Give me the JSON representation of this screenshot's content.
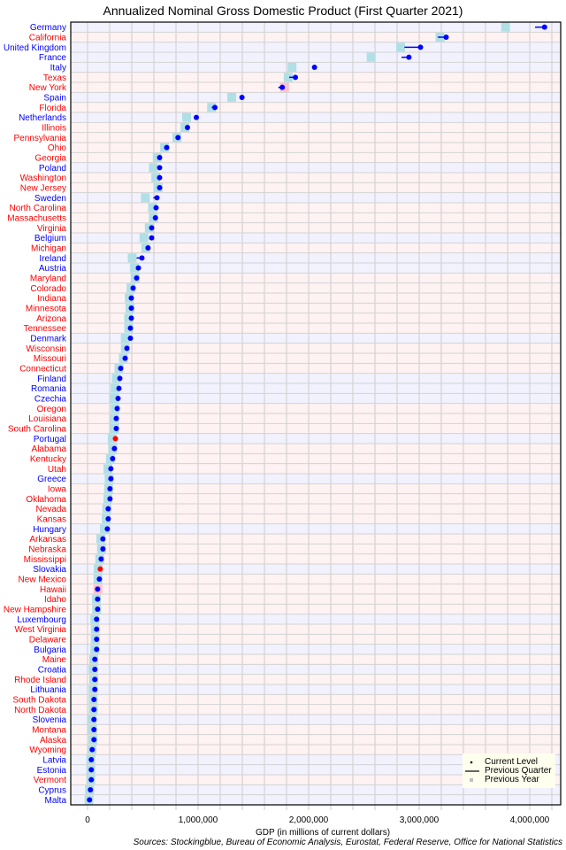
{
  "chart_data": {
    "type": "dot",
    "title": "Annualized Nominal Gross Domestic Product (First Quarter 2021)",
    "xlabel": "GDP (in millions of current dollars)",
    "ylabel": "",
    "source": "Sources: Stockingblue, Bureau of Economic Analysis, Eurostat, Federal Reserve, Office for National Statistics",
    "xlim": [
      -152000,
      4280000
    ],
    "xticks": [
      0,
      1000000,
      2000000,
      3000000,
      4000000
    ],
    "xtick_labels": [
      "0",
      "1,000,000",
      "2,000,000",
      "3,000,000",
      "4,000,000"
    ],
    "minor_tick_step": 200000,
    "grid": true,
    "legend_position": "bottom-right",
    "legend": [
      {
        "symbol": "dot",
        "label": "Current Level"
      },
      {
        "symbol": "line",
        "label": "Previous Quarter"
      },
      {
        "symbol": "square",
        "label": "Previous Year"
      }
    ],
    "colors": {
      "state_label": "#ff0000",
      "country_label": "#0000ff",
      "state_row": "#fff2f2",
      "country_row": "#f2f2ff",
      "dot": "#0000ff",
      "dot_highlight": "#ff0000",
      "prev_year_up": "#b0e0e6",
      "prev_year_down": "#ffc0cb",
      "grid": "#d3d3d3"
    },
    "series": [
      {
        "name": "Germany",
        "type": "country",
        "current": 4134000,
        "prev_quarter": 4048000,
        "prev_year": 3781000
      },
      {
        "name": "California",
        "type": "state",
        "current": 3244000,
        "prev_quarter": 3169000,
        "prev_year": 3188000
      },
      {
        "name": "United Kingdom",
        "type": "country",
        "current": 3012000,
        "prev_quarter": 2867000,
        "prev_year": 2832000
      },
      {
        "name": "France",
        "type": "country",
        "current": 2907000,
        "prev_quarter": 2840000,
        "prev_year": 2565000
      },
      {
        "name": "Italy",
        "type": "country",
        "current": 2053000,
        "prev_quarter": 2045000,
        "prev_year": 1850000
      },
      {
        "name": "Texas",
        "type": "state",
        "current": 1880000,
        "prev_quarter": 1824000,
        "prev_year": 1815000
      },
      {
        "name": "New York",
        "type": "state",
        "current": 1761000,
        "prev_quarter": 1726000,
        "prev_year": 1782000
      },
      {
        "name": "Spain",
        "type": "country",
        "current": 1397000,
        "prev_quarter": 1395000,
        "prev_year": 1304000
      },
      {
        "name": "Florida",
        "type": "state",
        "current": 1152000,
        "prev_quarter": 1124000,
        "prev_year": 1122000
      },
      {
        "name": "Netherlands",
        "type": "country",
        "current": 984000,
        "prev_quarter": 980000,
        "prev_year": 896000
      },
      {
        "name": "Illinois",
        "type": "state",
        "current": 904000,
        "prev_quarter": 885000,
        "prev_year": 880000
      },
      {
        "name": "Pennsylvania",
        "type": "state",
        "current": 818000,
        "prev_quarter": 800000,
        "prev_year": 808000
      },
      {
        "name": "Ohio",
        "type": "state",
        "current": 716000,
        "prev_quarter": 700000,
        "prev_year": 697000
      },
      {
        "name": "Georgia",
        "type": "state",
        "current": 652000,
        "prev_quarter": 640000,
        "prev_year": 630000
      },
      {
        "name": "Poland",
        "type": "country",
        "current": 652000,
        "prev_quarter": 648000,
        "prev_year": 595000
      },
      {
        "name": "Washington",
        "type": "state",
        "current": 652000,
        "prev_quarter": 640000,
        "prev_year": 617000
      },
      {
        "name": "New Jersey",
        "type": "state",
        "current": 652000,
        "prev_quarter": 640000,
        "prev_year": 638000
      },
      {
        "name": "Sweden",
        "type": "country",
        "current": 628000,
        "prev_quarter": 595000,
        "prev_year": 523000
      },
      {
        "name": "North Carolina",
        "type": "state",
        "current": 620000,
        "prev_quarter": 608000,
        "prev_year": 588000
      },
      {
        "name": "Massachusetts",
        "type": "state",
        "current": 614000,
        "prev_quarter": 604000,
        "prev_year": 595000
      },
      {
        "name": "Virginia",
        "type": "state",
        "current": 580000,
        "prev_quarter": 568000,
        "prev_year": 558000
      },
      {
        "name": "Belgium",
        "type": "country",
        "current": 580000,
        "prev_quarter": 562000,
        "prev_year": 510000
      },
      {
        "name": "Michigan",
        "type": "state",
        "current": 547000,
        "prev_quarter": 540000,
        "prev_year": 526000
      },
      {
        "name": "Ireland",
        "type": "country",
        "current": 492000,
        "prev_quarter": 444000,
        "prev_year": 404000
      },
      {
        "name": "Austria",
        "type": "country",
        "current": 460000,
        "prev_quarter": 452000,
        "prev_year": 425000
      },
      {
        "name": "Maryland",
        "type": "state",
        "current": 444000,
        "prev_quarter": 436000,
        "prev_year": 430000
      },
      {
        "name": "Colorado",
        "type": "state",
        "current": 412000,
        "prev_quarter": 404000,
        "prev_year": 393000
      },
      {
        "name": "Indiana",
        "type": "state",
        "current": 396000,
        "prev_quarter": 388000,
        "prev_year": 377000
      },
      {
        "name": "Minnesota",
        "type": "state",
        "current": 396000,
        "prev_quarter": 388000,
        "prev_year": 383000
      },
      {
        "name": "Arizona",
        "type": "state",
        "current": 396000,
        "prev_quarter": 388000,
        "prev_year": 372000
      },
      {
        "name": "Tennessee",
        "type": "state",
        "current": 388000,
        "prev_quarter": 380000,
        "prev_year": 372000
      },
      {
        "name": "Denmark",
        "type": "country",
        "current": 388000,
        "prev_quarter": 384000,
        "prev_year": 341000
      },
      {
        "name": "Wisconsin",
        "type": "state",
        "current": 356000,
        "prev_quarter": 350000,
        "prev_year": 341000
      },
      {
        "name": "Missouri",
        "type": "state",
        "current": 340000,
        "prev_quarter": 334000,
        "prev_year": 324000
      },
      {
        "name": "Connecticut",
        "type": "state",
        "current": 300000,
        "prev_quarter": 294000,
        "prev_year": 284000
      },
      {
        "name": "Finland",
        "type": "country",
        "current": 292000,
        "prev_quarter": 288000,
        "prev_year": 260000
      },
      {
        "name": "Romania",
        "type": "country",
        "current": 284000,
        "prev_quarter": 280000,
        "prev_year": 249000
      },
      {
        "name": "Czechia",
        "type": "country",
        "current": 276000,
        "prev_quarter": 272000,
        "prev_year": 244000
      },
      {
        "name": "Oregon",
        "type": "state",
        "current": 268000,
        "prev_quarter": 264000,
        "prev_year": 249000
      },
      {
        "name": "Louisiana",
        "type": "state",
        "current": 260000,
        "prev_quarter": 256000,
        "prev_year": 244000
      },
      {
        "name": "South Carolina",
        "type": "state",
        "current": 260000,
        "prev_quarter": 256000,
        "prev_year": 244000
      },
      {
        "name": "Portugal",
        "type": "country",
        "current": 252000,
        "prev_quarter": 254000,
        "prev_year": 223000,
        "highlight": true
      },
      {
        "name": "Alabama",
        "type": "state",
        "current": 243000,
        "prev_quarter": 239000,
        "prev_year": 227000
      },
      {
        "name": "Kentucky",
        "type": "state",
        "current": 227000,
        "prev_quarter": 223000,
        "prev_year": 206000
      },
      {
        "name": "Utah",
        "type": "state",
        "current": 211000,
        "prev_quarter": 207000,
        "prev_year": 184000
      },
      {
        "name": "Greece",
        "type": "country",
        "current": 211000,
        "prev_quarter": 209000,
        "prev_year": 195000
      },
      {
        "name": "Iowa",
        "type": "state",
        "current": 203000,
        "prev_quarter": 199000,
        "prev_year": 190000
      },
      {
        "name": "Oklahoma",
        "type": "state",
        "current": 203000,
        "prev_quarter": 199000,
        "prev_year": 184000
      },
      {
        "name": "Nevada",
        "type": "state",
        "current": 187000,
        "prev_quarter": 183000,
        "prev_year": 174000
      },
      {
        "name": "Kansas",
        "type": "state",
        "current": 187000,
        "prev_quarter": 184000,
        "prev_year": 168000
      },
      {
        "name": "Hungary",
        "type": "country",
        "current": 179000,
        "prev_quarter": 176000,
        "prev_year": 152000
      },
      {
        "name": "Arkansas",
        "type": "state",
        "current": 139000,
        "prev_quarter": 136000,
        "prev_year": 120000
      },
      {
        "name": "Nebraska",
        "type": "state",
        "current": 139000,
        "prev_quarter": 136000,
        "prev_year": 126000
      },
      {
        "name": "Mississippi",
        "type": "state",
        "current": 123000,
        "prev_quarter": 120000,
        "prev_year": 110000
      },
      {
        "name": "Slovakia",
        "type": "country",
        "current": 115000,
        "prev_quarter": 116000,
        "prev_year": 96000,
        "highlight": true
      },
      {
        "name": "New Mexico",
        "type": "state",
        "current": 107000,
        "prev_quarter": 104000,
        "prev_year": 94000
      },
      {
        "name": "Hawaii",
        "type": "state",
        "current": 91000,
        "prev_quarter": 89000,
        "prev_year": 94000
      },
      {
        "name": "Idaho",
        "type": "state",
        "current": 91000,
        "prev_quarter": 89000,
        "prev_year": 80000
      },
      {
        "name": "New Hampshire",
        "type": "state",
        "current": 91000,
        "prev_quarter": 89000,
        "prev_year": 82000
      },
      {
        "name": "Luxembourg",
        "type": "country",
        "current": 82000,
        "prev_quarter": 80000,
        "prev_year": 66000
      },
      {
        "name": "West Virginia",
        "type": "state",
        "current": 82000,
        "prev_quarter": 80000,
        "prev_year": 69000
      },
      {
        "name": "Delaware",
        "type": "state",
        "current": 82000,
        "prev_quarter": 80000,
        "prev_year": 69000
      },
      {
        "name": "Bulgaria",
        "type": "country",
        "current": 82000,
        "prev_quarter": 80000,
        "prev_year": 66000
      },
      {
        "name": "Maine",
        "type": "state",
        "current": 66000,
        "prev_quarter": 64000,
        "prev_year": 56000
      },
      {
        "name": "Croatia",
        "type": "country",
        "current": 66000,
        "prev_quarter": 64000,
        "prev_year": 51000
      },
      {
        "name": "Rhode Island",
        "type": "state",
        "current": 66000,
        "prev_quarter": 64000,
        "prev_year": 56000
      },
      {
        "name": "Lithuania",
        "type": "country",
        "current": 66000,
        "prev_quarter": 64000,
        "prev_year": 51000
      },
      {
        "name": "South Dakota",
        "type": "state",
        "current": 58000,
        "prev_quarter": 57000,
        "prev_year": 51000
      },
      {
        "name": "North Dakota",
        "type": "state",
        "current": 58000,
        "prev_quarter": 57000,
        "prev_year": 51000
      },
      {
        "name": "Slovenia",
        "type": "country",
        "current": 58000,
        "prev_quarter": 57000,
        "prev_year": 42000
      },
      {
        "name": "Montana",
        "type": "state",
        "current": 58000,
        "prev_quarter": 57000,
        "prev_year": 45000
      },
      {
        "name": "Alaska",
        "type": "state",
        "current": 58000,
        "prev_quarter": 57000,
        "prev_year": 48000
      },
      {
        "name": "Wyoming",
        "type": "state",
        "current": 42000,
        "prev_quarter": 41000,
        "prev_year": 40000
      },
      {
        "name": "Latvia",
        "type": "country",
        "current": 34000,
        "prev_quarter": 33000,
        "prev_year": 29000
      },
      {
        "name": "Estonia",
        "type": "country",
        "current": 34000,
        "prev_quarter": 33000,
        "prev_year": 29000
      },
      {
        "name": "Vermont",
        "type": "state",
        "current": 34000,
        "prev_quarter": 33000,
        "prev_year": 29000
      },
      {
        "name": "Cyprus",
        "type": "country",
        "current": 26000,
        "prev_quarter": 25000,
        "prev_year": 18000
      },
      {
        "name": "Malta",
        "type": "country",
        "current": 18000,
        "prev_quarter": 17000,
        "prev_year": 13000
      }
    ]
  }
}
